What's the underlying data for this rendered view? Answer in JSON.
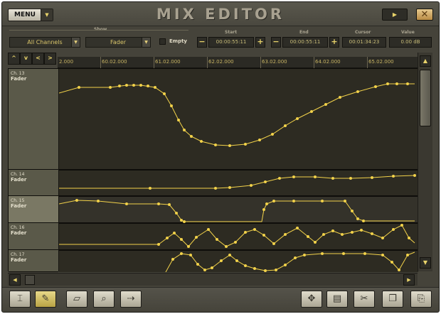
{
  "app": {
    "title": "MIX EDITOR",
    "menu_label": "MENU",
    "menu_dropdown_icon": "▼",
    "play_icon": "▶",
    "close_icon": "✕"
  },
  "controls": {
    "show_label": "Show",
    "channels_select": "All Channels",
    "parameter_select": "Fader",
    "empty_label": "Empty",
    "start_label": "Start",
    "start_value": "00:00:55:11",
    "end_label": "End",
    "end_value": "00:00:55:11",
    "cursor_label": "Cursor",
    "cursor_value": "00:01:34:23",
    "value_label": "Value",
    "value_value": "0.00 dB",
    "minus": "−",
    "plus": "+"
  },
  "nav_buttons": [
    "^",
    "v",
    "<",
    ">"
  ],
  "ruler": {
    "ticks": [
      "2.000",
      "60.02.000",
      "61.02.000",
      "62.02.000",
      "63.02.000",
      "64.02.000",
      "65.02.000"
    ]
  },
  "lanes": [
    {
      "channel": "Ch. 13",
      "param": "Fader"
    },
    {
      "channel": "Ch. 14",
      "param": "Fader"
    },
    {
      "channel": "Ch. 15",
      "param": "Fader"
    },
    {
      "channel": "Ch. 16",
      "param": "Fader"
    },
    {
      "channel": "Ch. 17",
      "param": "Fader"
    }
  ],
  "scroll": {
    "up": "▲",
    "down": "▼",
    "left": "◀",
    "right": "▶"
  },
  "toolbar": {
    "tools": [
      "cursor-tool",
      "pencil-tool",
      "eraser-tool",
      "zoom-tool",
      "move-right-tool",
      "move-tool",
      "trash-tool",
      "cut-tool",
      "copy-tool",
      "paste-tool"
    ]
  },
  "colors": {
    "curve": "#f2d24a",
    "background": "#45433a",
    "lane_fill": "#2d2b22"
  }
}
